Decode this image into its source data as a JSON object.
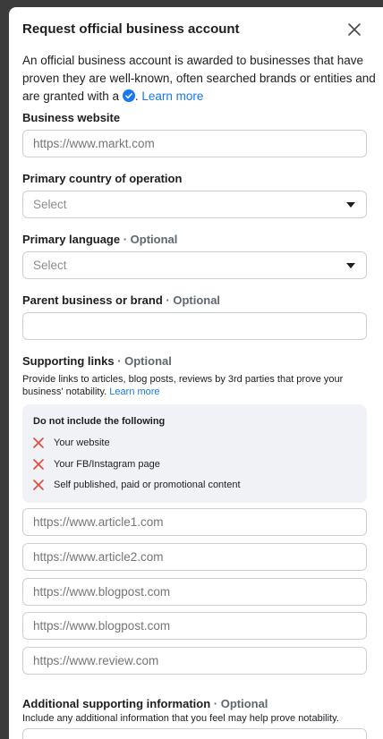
{
  "dialog": {
    "title": "Request official business account",
    "intro_text": "An official business account is awarded to businesses that have proven they are well-known, often searched brands or entities and are granted with a",
    "intro_after_badge": ".",
    "learn_more": "Learn more"
  },
  "business_website": {
    "label": "Business website",
    "placeholder": "https://www.markt.com"
  },
  "primary_country": {
    "label": "Primary country of operation",
    "value": "Select"
  },
  "primary_language": {
    "label": "Primary language",
    "optional": "· Optional",
    "value": "Select"
  },
  "parent_business": {
    "label": "Parent business or brand",
    "optional": "· Optional",
    "value": ""
  },
  "supporting_links": {
    "label": "Supporting links",
    "optional": "· Optional",
    "help": "Provide links to articles, blog posts, reviews by 3rd parties that prove your business' notability.",
    "learn_more": "Learn more",
    "exclusions_title": "Do not include the following",
    "exclusions": [
      "Your website",
      "Your FB/Instagram page",
      "Self published, paid or promotional content"
    ],
    "placeholders": [
      "https://www.article1.com",
      "https://www.article2.com",
      "https://www.blogpost.com",
      "https://www.blogpost.com",
      "https://www.review.com"
    ]
  },
  "additional_info": {
    "label": "Additional supporting information",
    "optional": "· Optional",
    "help": "Include any additional information that you feel may help prove notability."
  },
  "colors": {
    "accent": "#1877f2",
    "error": "#e4483a",
    "panel_bg": "#ffffff",
    "note_bg": "#f0f2f5"
  }
}
